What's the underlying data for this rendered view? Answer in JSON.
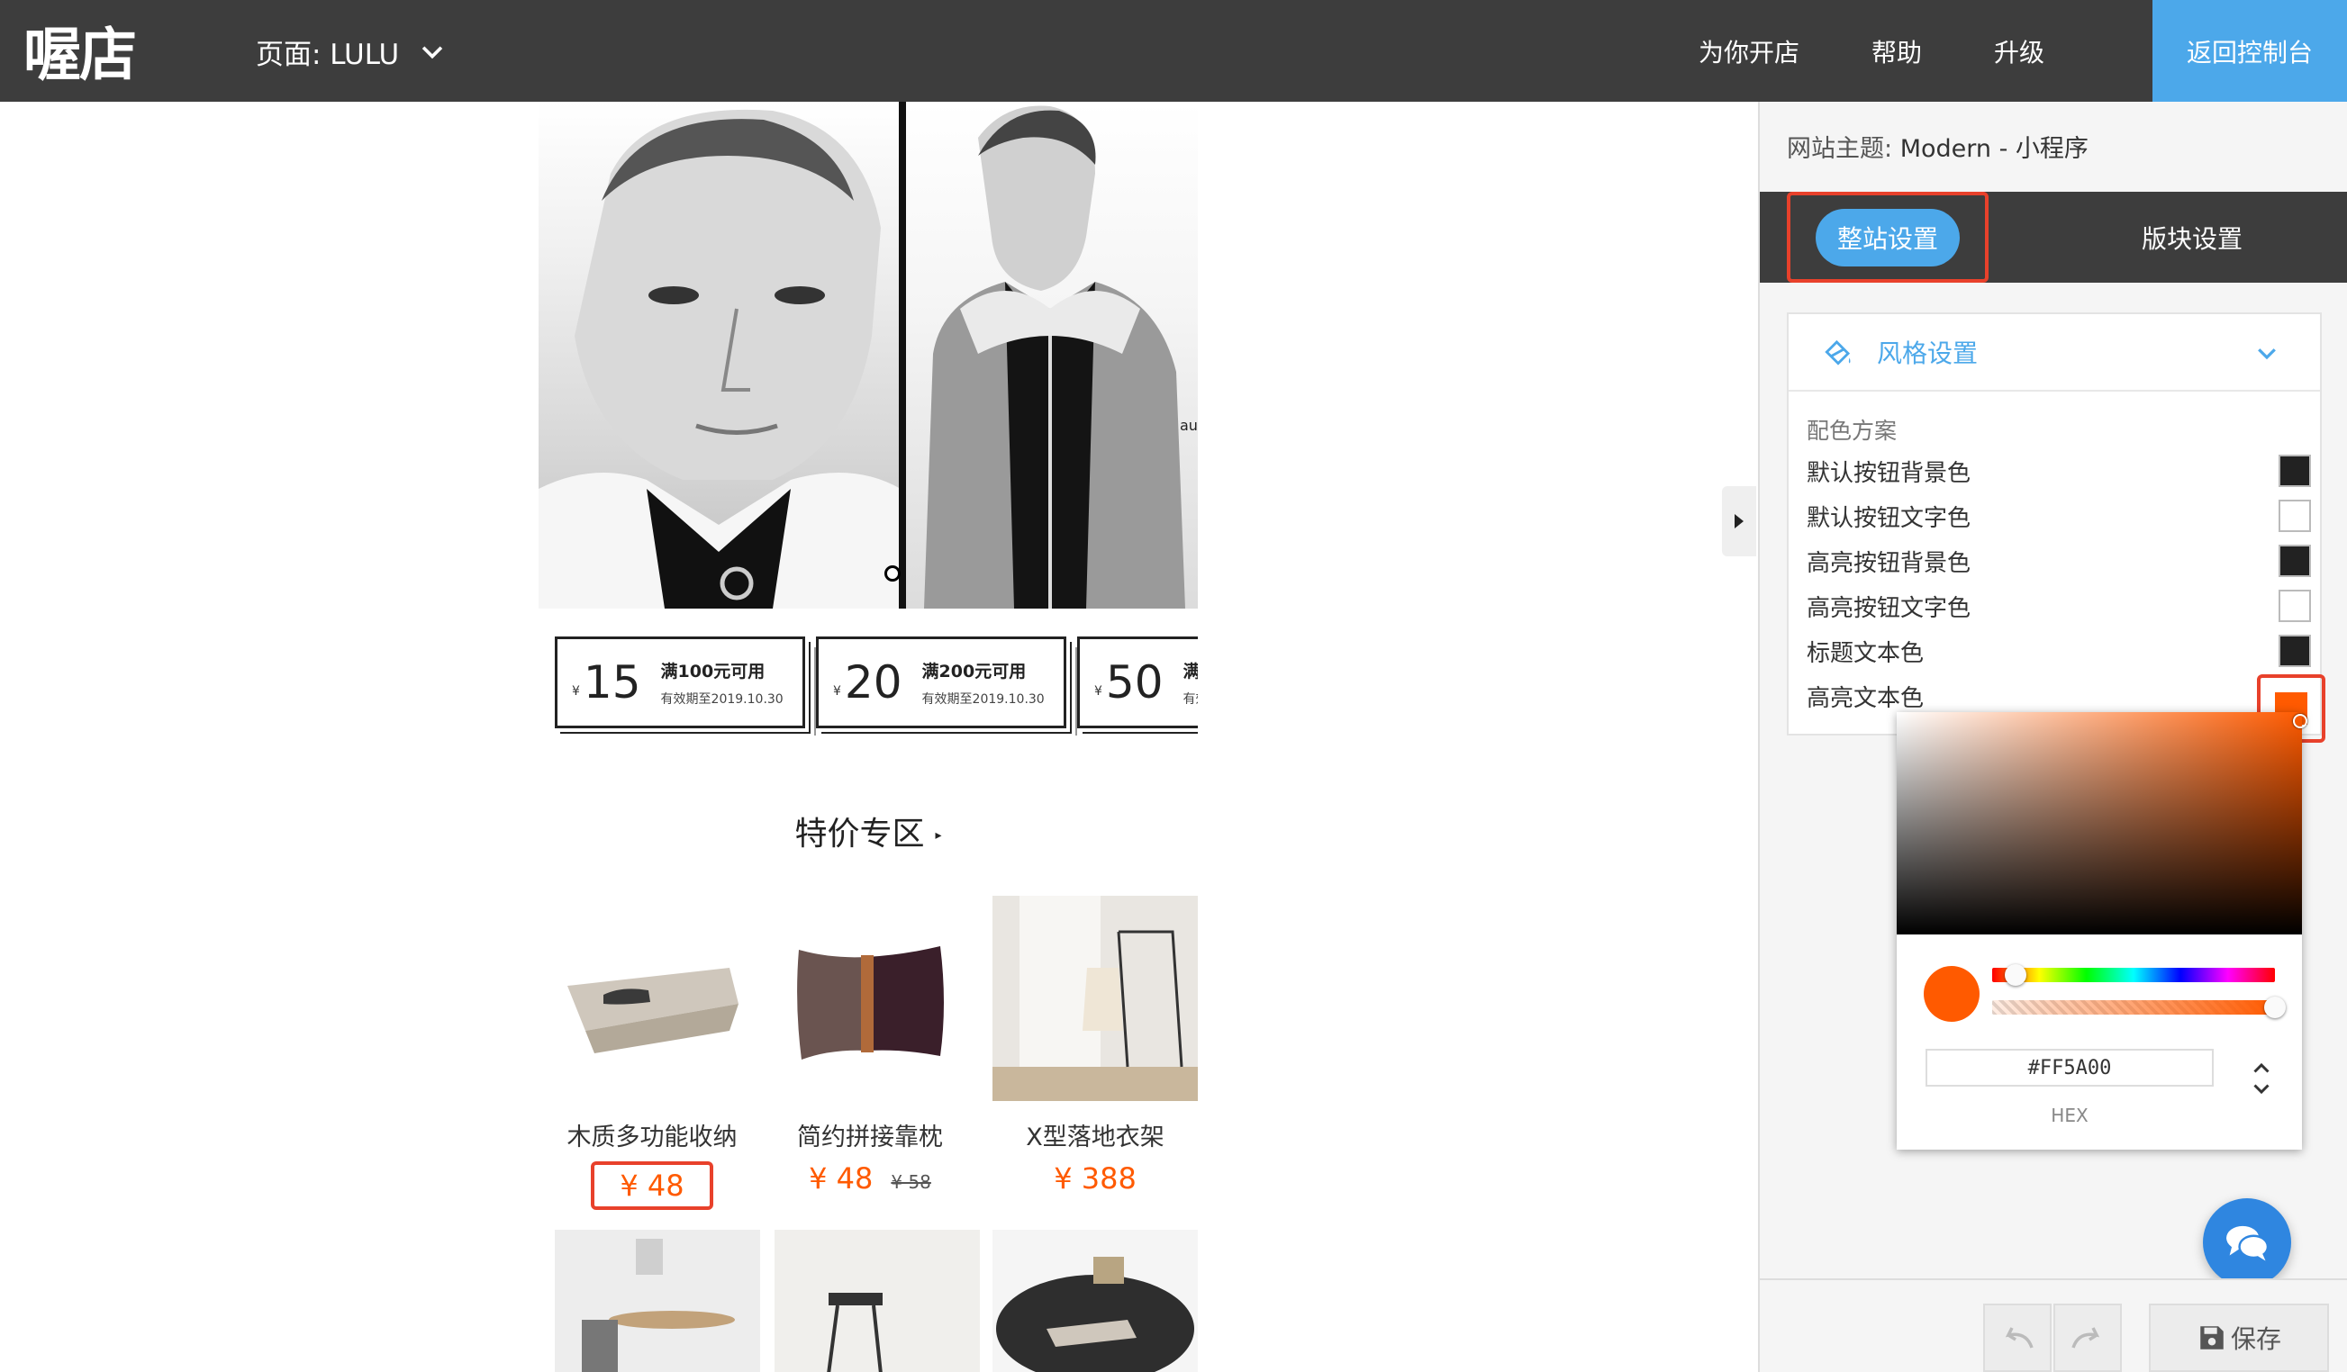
{
  "topbar": {
    "logo_text": "喔店",
    "page_selector": "页面: LULU",
    "nav": [
      "为你开店",
      "帮助",
      "升级"
    ],
    "back_button": "返回控制台"
  },
  "preview": {
    "hero_caption": "autu",
    "coupons": [
      {
        "currency": "¥",
        "amount": "15",
        "condition": "满100元可用",
        "expiry": "有效期至2019.10.30"
      },
      {
        "currency": "¥",
        "amount": "20",
        "condition": "满200元可用",
        "expiry": "有效期至2019.10.30"
      },
      {
        "currency": "¥",
        "amount": "50",
        "condition": "满",
        "expiry": "有效"
      }
    ],
    "section_title": "特价专区",
    "section_arrow": "▸",
    "products": [
      {
        "name": "木质多功能收纳",
        "price": "¥ 48",
        "old_price": ""
      },
      {
        "name": "简约拼接靠枕",
        "price": "¥ 48",
        "old_price": "¥ 58"
      },
      {
        "name": "X型落地衣架",
        "price": "¥ 388",
        "old_price": ""
      }
    ]
  },
  "panel": {
    "theme_label": "网站主题:",
    "theme_value": "Modern - 小程序",
    "tabs": [
      "整站设置",
      "版块设置"
    ],
    "style_section_title": "风格设置",
    "scheme_label": "配色方案",
    "color_rows": [
      {
        "label": "默认按钮背景色",
        "color": "#222222"
      },
      {
        "label": "默认按钮文字色",
        "color": "#ffffff"
      },
      {
        "label": "高亮按钮背景色",
        "color": "#222222"
      },
      {
        "label": "高亮按钮文字色",
        "color": "#ffffff"
      },
      {
        "label": "标题文本色",
        "color": "#222222"
      },
      {
        "label": "高亮文本色",
        "color": "#ff5a00"
      }
    ],
    "picker": {
      "hex_value": "#FF5A00",
      "mode_label": "HEX"
    },
    "save_label": "保存"
  },
  "colors": {
    "accent_blue": "#4ca8ea",
    "highlight_orange": "#ff5a00",
    "annotation_red": "#e8412b",
    "topbar_bg": "#3d3d3d"
  }
}
